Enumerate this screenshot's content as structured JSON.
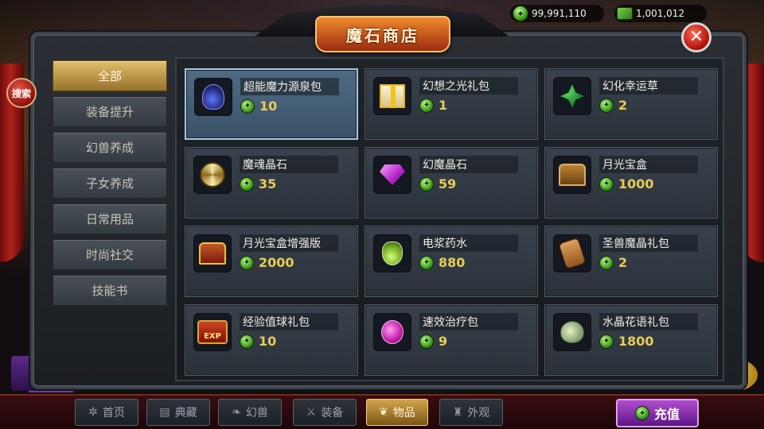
{
  "currency": {
    "crystals": "99,991,110",
    "tickets": "1,001,012"
  },
  "window": {
    "title": "魔石商店",
    "close_label": "✕"
  },
  "search_label": "搜索",
  "categories": [
    {
      "label": "全部",
      "active": true
    },
    {
      "label": "装备提升",
      "active": false
    },
    {
      "label": "幻兽养成",
      "active": false
    },
    {
      "label": "子女养成",
      "active": false
    },
    {
      "label": "日常用品",
      "active": false
    },
    {
      "label": "时尚社交",
      "active": false
    },
    {
      "label": "技能书",
      "active": false
    }
  ],
  "items": [
    {
      "name": "超能魔力源泉包",
      "price": "10",
      "icon": "mana-pack-icon",
      "selected": true
    },
    {
      "name": "幻想之光礼包",
      "price": "1",
      "icon": "gift-box-icon",
      "selected": false
    },
    {
      "name": "幻化幸运草",
      "price": "2",
      "icon": "clover-icon",
      "selected": false
    },
    {
      "name": "魔魂晶石",
      "price": "35",
      "icon": "soul-disc-icon",
      "selected": false
    },
    {
      "name": "幻魔晶石",
      "price": "59",
      "icon": "purple-gem-icon",
      "selected": false
    },
    {
      "name": "月光宝盒",
      "price": "1000",
      "icon": "treasure-chest-icon",
      "selected": false
    },
    {
      "name": "月光宝盒增强版",
      "price": "2000",
      "icon": "red-chest-icon",
      "selected": false
    },
    {
      "name": "电浆药水",
      "price": "880",
      "icon": "green-potion-icon",
      "selected": false
    },
    {
      "name": "圣兽魔晶礼包",
      "price": "2",
      "icon": "glove-icon",
      "selected": false
    },
    {
      "name": "经验值球礼包",
      "price": "10",
      "icon": "exp-chest-icon",
      "selected": false
    },
    {
      "name": "速效治疗包",
      "price": "9",
      "icon": "pink-potion-icon",
      "selected": false
    },
    {
      "name": "水晶花语礼包",
      "price": "1800",
      "icon": "sack-icon",
      "selected": false
    }
  ],
  "exp_label": "EXP",
  "bottom_nav": [
    {
      "label": "首页",
      "icon": "home-icon",
      "active": false
    },
    {
      "label": "典藏",
      "icon": "collection-icon",
      "active": false
    },
    {
      "label": "幻兽",
      "icon": "beast-icon",
      "active": false
    },
    {
      "label": "装备",
      "icon": "equipment-icon",
      "active": false
    },
    {
      "label": "物品",
      "icon": "item-icon",
      "active": true
    },
    {
      "label": "外观",
      "icon": "appearance-icon",
      "active": false
    }
  ],
  "recharge_label": "充值",
  "colors": {
    "price": "#e8cc55",
    "active_tab": "#d2a54a",
    "recharge": "#8e2fb0",
    "selected_card": "#4f6b84"
  }
}
